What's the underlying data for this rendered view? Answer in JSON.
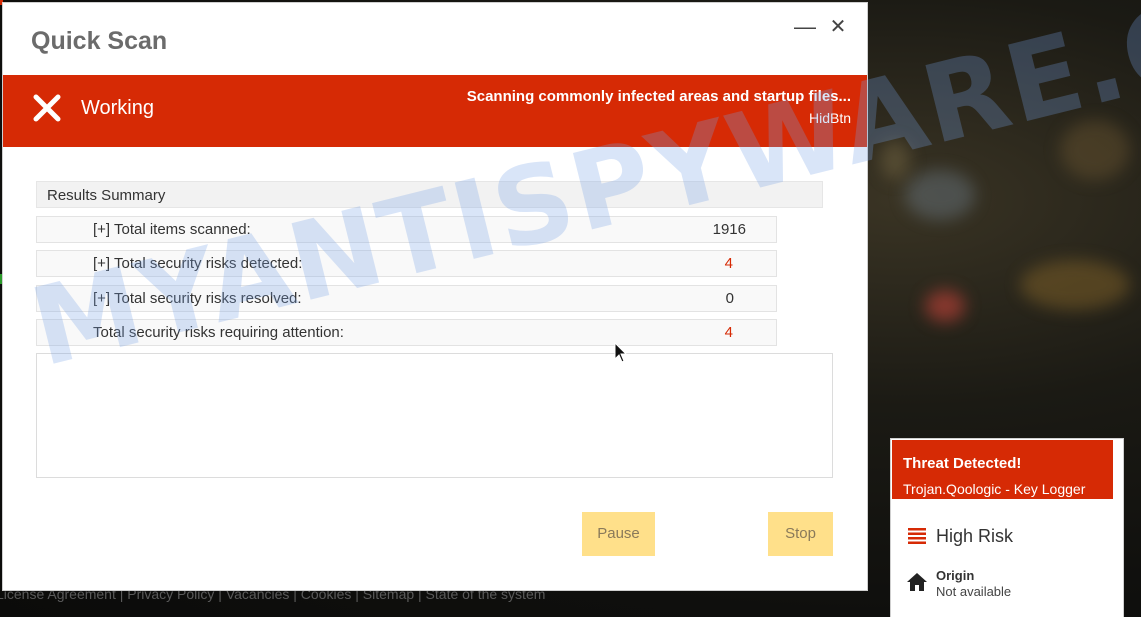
{
  "dialog": {
    "title": "Quick Scan",
    "minimize_glyph": "—",
    "close_glyph": "✕"
  },
  "status": {
    "state": "Working",
    "message": "Scanning commonly infected areas and startup files...",
    "sub": "HidBtn",
    "icon": "x-icon"
  },
  "results": {
    "header": "Results Summary",
    "rows": [
      {
        "label": "[+] Total items scanned:",
        "value": "1916"
      },
      {
        "label": "[+] Total security risks detected:",
        "value": "4"
      },
      {
        "label": "[+] Total security risks resolved:",
        "value": "0"
      },
      {
        "label": "Total security risks requiring attention:",
        "value": "4"
      }
    ]
  },
  "buttons": {
    "pause": "Pause",
    "stop": "Stop"
  },
  "threat_popup": {
    "title": "Threat Detected!",
    "name": "Trojan.Qoologic - Key Logger",
    "risk": "High Risk",
    "origin_label": "Origin",
    "origin_value": "Not available"
  },
  "background_footer": "License Agreement | Privacy Policy | Vacancies | Cookies | Sitemap | State of the system",
  "watermark": "MYANTISPYWARE.COM",
  "colors": {
    "accent_red": "#d62a05",
    "button_yellow": "#ffe08a",
    "value_red": "#d62a05"
  }
}
